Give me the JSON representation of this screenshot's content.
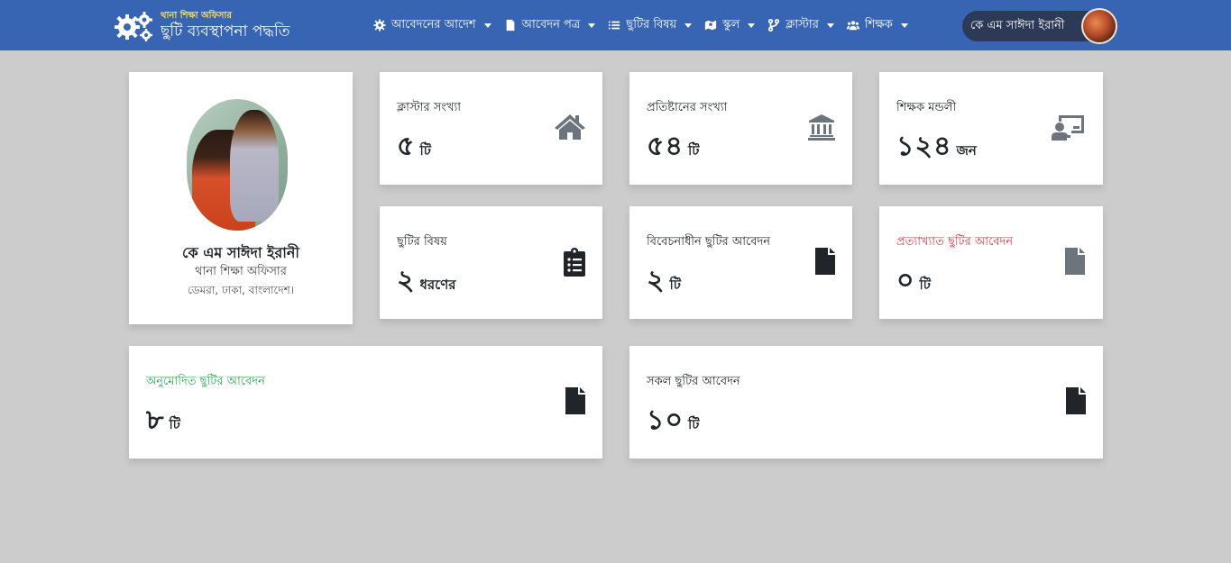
{
  "header": {
    "brand_sub": "থানা শিক্ষা অফিসার",
    "brand_title": "ছুটি ব্যবস্থাপনা পদ্ধতি",
    "brand_icon": "gears-icon",
    "nav": [
      {
        "label": "আবেদনের আদেশ",
        "icon": "cog-icon"
      },
      {
        "label": "আবেদন পত্র",
        "icon": "file-icon"
      },
      {
        "label": "ছুটির বিষয়",
        "icon": "list-icon"
      },
      {
        "label": "স্কুল",
        "icon": "map-icon"
      },
      {
        "label": "ক্লাস্টার",
        "icon": "branch-icon"
      },
      {
        "label": "শিক্ষক",
        "icon": "users-icon"
      }
    ],
    "user_name": "কে এম সাঈদা ইরানী"
  },
  "profile": {
    "name": "কে এম সাঈদা ইরানী",
    "role": "থানা শিক্ষা অফিসার",
    "address": "ডেমরা, ঢাকা, বাংলাদেশ।"
  },
  "stats": [
    {
      "label": "ক্লাস্টার সংখ্যা",
      "value": "৫",
      "unit": "টি",
      "icon": "home-icon",
      "label_color": "#212529",
      "icon_color": "#6c757d"
    },
    {
      "label": "প্রতিষ্টানের সংখ্যা",
      "value": "৫৪",
      "unit": "টি",
      "icon": "university-icon",
      "label_color": "#212529",
      "icon_color": "#6c757d"
    },
    {
      "label": "শিক্ষক মন্ডলী",
      "value": "১২৪",
      "unit": "জন",
      "icon": "teacher-icon",
      "label_color": "#212529",
      "icon_color": "#6c757d"
    },
    {
      "label": "ছুটির বিষয়",
      "value": "২",
      "unit": "ধরণের",
      "icon": "clipboard-list-icon",
      "label_color": "#212529",
      "icon_color": "#212529"
    },
    {
      "label": "বিবেচনাধীন ছুটির আবেদন",
      "value": "২",
      "unit": "টি",
      "icon": "file-icon",
      "label_color": "#212529",
      "icon_color": "#212529"
    },
    {
      "label": "প্রত্যাখ্যাত ছুটির আবেদন",
      "value": "০",
      "unit": "টি",
      "icon": "file-icon",
      "label_color": "#dc3545",
      "icon_color": "#6c757d"
    },
    {
      "label": "অনুমোদিত ছুটির আবেদন",
      "value": "৮",
      "unit": "টি",
      "icon": "file-icon",
      "label_color": "#28a745",
      "icon_color": "#212529"
    },
    {
      "label": "সকল ছুটির আবেদন",
      "value": "১০",
      "unit": "টি",
      "icon": "file-icon",
      "label_color": "#212529",
      "icon_color": "#212529"
    }
  ],
  "colors": {
    "navbar": "#3864b4",
    "background": "#cccccc",
    "user_pill": "#2d3a57",
    "brand_sub": "#ffe14a"
  }
}
